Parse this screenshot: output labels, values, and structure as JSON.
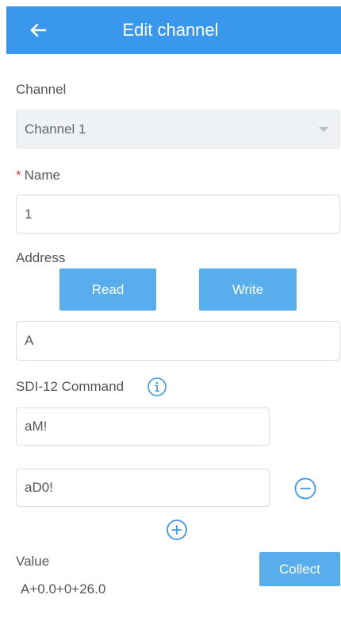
{
  "header": {
    "title": "Edit channel",
    "back_icon": "arrow-left-icon"
  },
  "channel": {
    "label": "Channel",
    "selected": "Channel 1"
  },
  "name": {
    "label": "Name",
    "required_mark": "*",
    "value": "1"
  },
  "address": {
    "label": "Address",
    "read_label": "Read",
    "write_label": "Write",
    "value": "A"
  },
  "sdi12": {
    "label": "SDI-12 Command",
    "info_icon": "info-icon",
    "commands": [
      "aM!",
      "aD0!"
    ],
    "remove_icon": "minus-circle-icon",
    "add_icon": "plus-circle-icon"
  },
  "value": {
    "label": "Value",
    "collect_label": "Collect",
    "reading": "A+0.0+0+26.0"
  },
  "colors": {
    "primary": "#3a98ec",
    "button": "#58adec",
    "required": "#e53935"
  }
}
